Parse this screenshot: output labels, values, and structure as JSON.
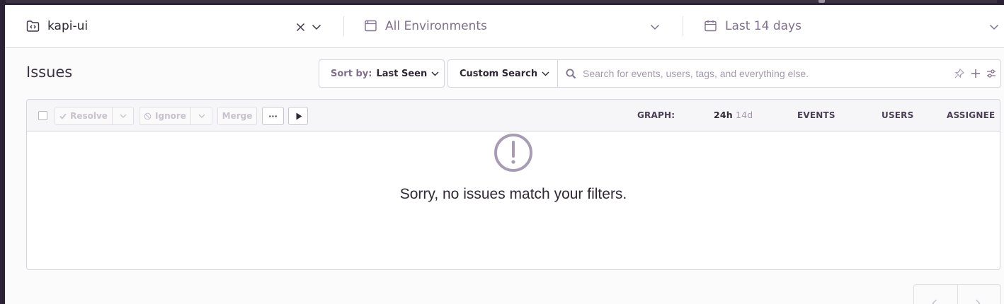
{
  "header": {
    "project": {
      "icon": "project-folder-icon",
      "name": "kapi-ui",
      "clear_icon": "close-icon",
      "dropdown_icon": "chevron-down-icon"
    },
    "environment": {
      "icon": "environment-window-icon",
      "label": "All Environments",
      "dropdown_icon": "chevron-down-icon"
    },
    "date_range": {
      "icon": "calendar-icon",
      "label": "Last 14 days",
      "dropdown_icon": "chevron-down-icon"
    }
  },
  "page": {
    "title": "Issues",
    "sort": {
      "label": "Sort by:",
      "value": "Last Seen"
    },
    "custom_search": {
      "label": "Custom Search"
    },
    "search": {
      "value": "",
      "placeholder": "Search for events, users, tags, and everything else.",
      "icons": [
        "search-icon",
        "pin-icon",
        "plus-icon",
        "settings-sliders-icon"
      ]
    }
  },
  "toolbar": {
    "resolve_label": "Resolve",
    "ignore_label": "Ignore",
    "merge_label": "Merge",
    "more_label": "···",
    "columns": {
      "graph_label": "GRAPH:",
      "graph_24h": "24h",
      "graph_14d": "14d",
      "events": "EVENTS",
      "users": "USERS",
      "assignee": "ASSIGNEE"
    }
  },
  "empty_state": {
    "icon": "exclamation-circle-icon",
    "message": "Sorry, no issues match your filters."
  },
  "pagination": {
    "prev_icon": "chevron-left-icon",
    "next_icon": "chevron-right-icon"
  },
  "colors": {
    "brand_dark": "#2b2233",
    "text": "#2f2936",
    "muted": "#80708f",
    "icon_muted": "#a89cb5",
    "border": "#d8d4de"
  }
}
